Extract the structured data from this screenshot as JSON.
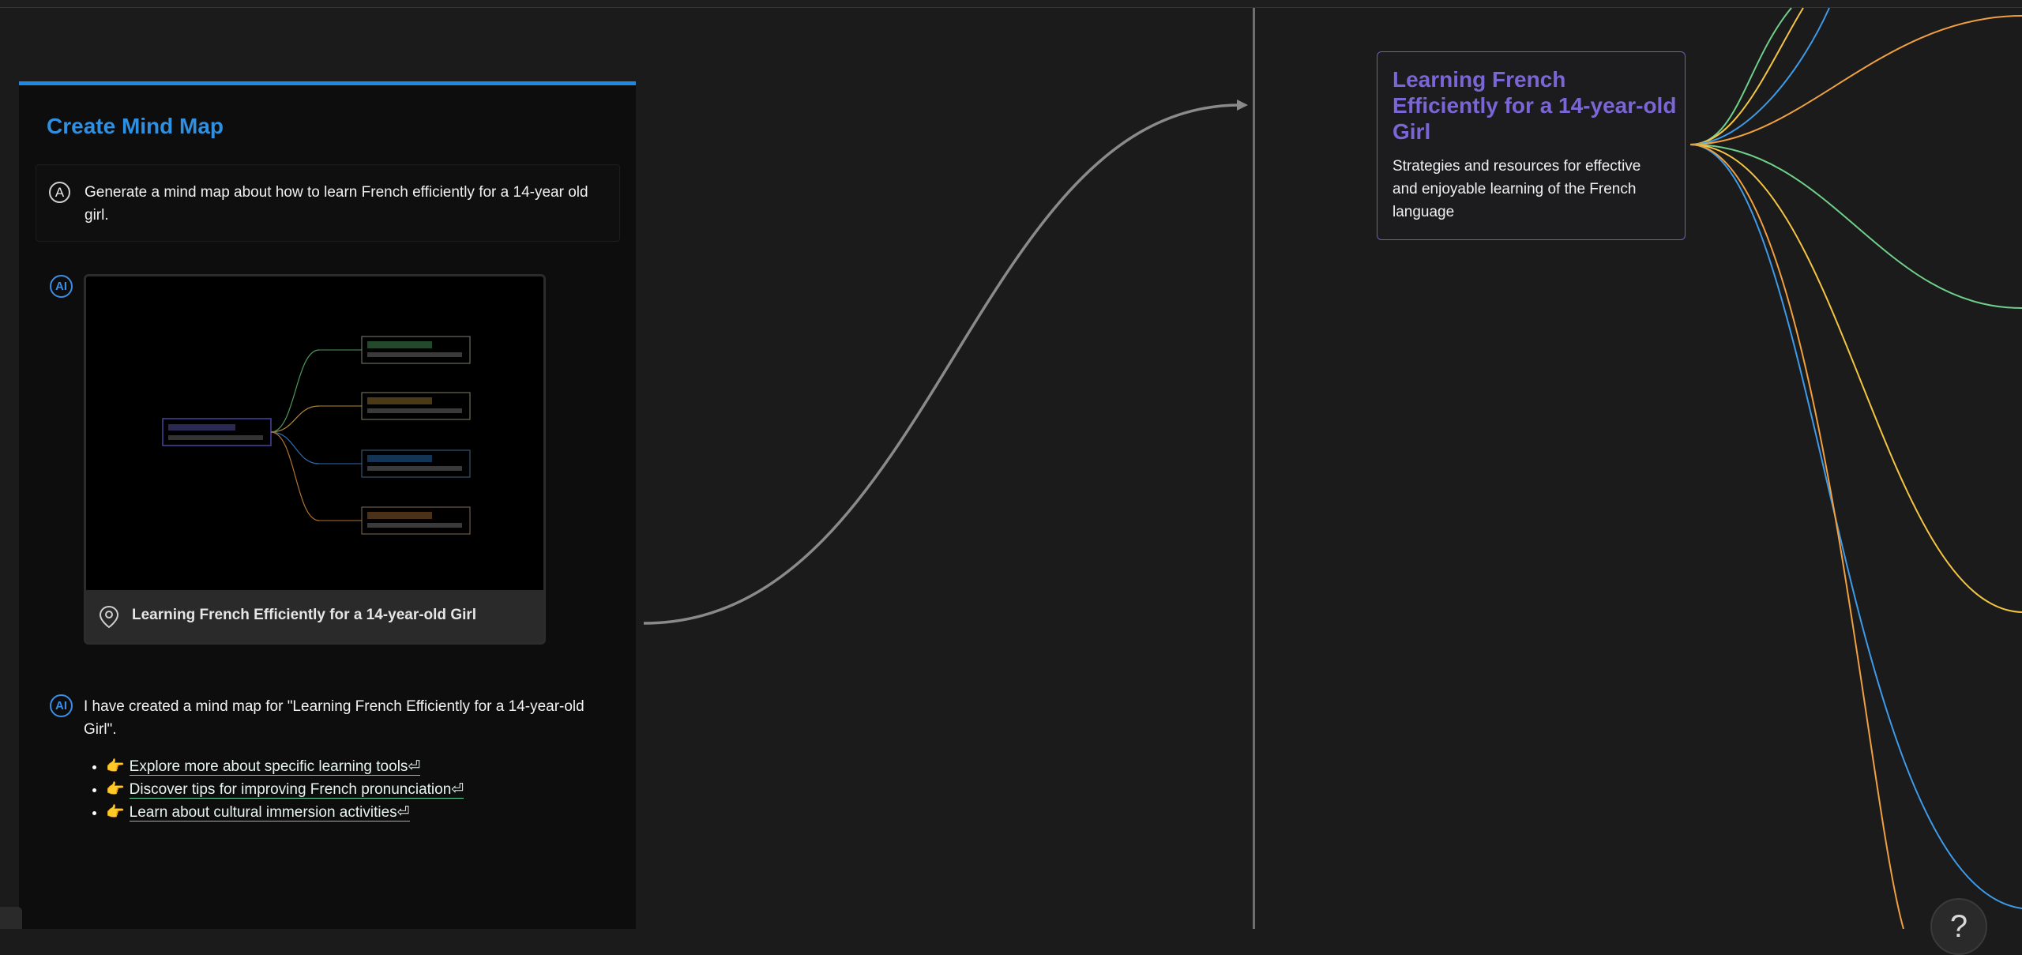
{
  "panel": {
    "title": "Create Mind Map",
    "user_avatar": "A",
    "user_message": "Generate a mind map about how to learn French efficiently for a 14-year old girl.",
    "ai_badge": "AI",
    "card_label": "Learning French Efficiently for a 14-year-old Girl",
    "ai_response": "I have created a mind map for \"Learning French Efficiently for a 14-year-old Girl\".",
    "links": [
      {
        "emoji": "👉",
        "text": "Explore more about specific learning tools⏎"
      },
      {
        "emoji": "👉",
        "text": "Discover tips for improving French pronunciation⏎"
      },
      {
        "emoji": "👉",
        "text": "Learn about cultural immersion activities⏎"
      }
    ]
  },
  "mindmap": {
    "root_title": "Learning French Efficiently for a 14-year-old Girl",
    "root_description": "Strategies and resources for effective and enjoyable learning of the French language",
    "branch_colors": [
      "#6fd08a",
      "#f4c542",
      "#3d9be9",
      "#f0a040"
    ]
  },
  "help_label": "?"
}
